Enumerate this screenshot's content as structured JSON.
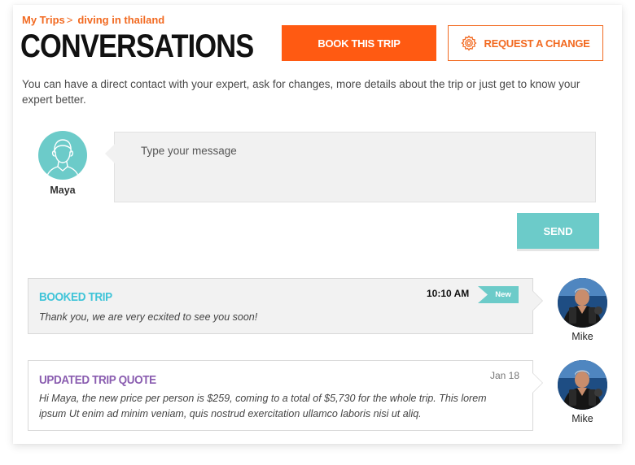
{
  "breadcrumb": {
    "root": "My Trips",
    "separator": ">",
    "current": "diving in thailand"
  },
  "header": {
    "title": "CONVERSATIONS",
    "book_label": "BOOK THIS TRIP",
    "change_label": "REQUEST A CHANGE"
  },
  "intro": "You can have a direct contact with your expert, ask for changes, more details about the trip or just get to know your expert better.",
  "composer": {
    "user_name": "Maya",
    "placeholder": "Type your message",
    "send_label": "SEND"
  },
  "messages": [
    {
      "title": "BOOKED TRIP",
      "body": "Thank you, we are very ecxited to see you soon!",
      "time": "10:10 AM",
      "badge": "New",
      "sender": "Mike"
    },
    {
      "title": "UPDATED TRIP QUOTE",
      "body": "Hi Maya, the new price per person is $259, coming to a total of $5,730 for the whole trip. This lorem ipsum Ut enim ad minim veniam, quis nostrud exercitation ullamco laboris nisi ut aliq.",
      "date": "Jan 18",
      "sender": "Mike"
    }
  ],
  "colors": {
    "orange": "#f26a21",
    "orange_button": "#ff5a12",
    "teal": "#6ccbc9",
    "title_teal": "#3fc4d8",
    "title_purple": "#8a5db0"
  },
  "icons": {
    "request_change": "gear-icon",
    "maya_avatar": "user-outline-icon"
  }
}
